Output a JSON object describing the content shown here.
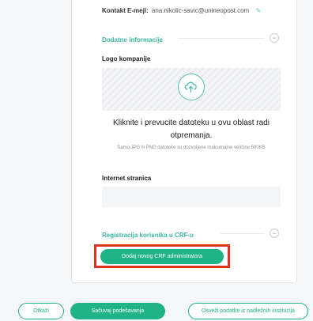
{
  "contact": {
    "label": "Kontakt E-mejl:",
    "value": "ana.nikolic-savic@unineopost.com"
  },
  "additional_info": {
    "title": "Dodatne informacije",
    "toggle_symbol": "−"
  },
  "logo": {
    "label": "Logo kompanije",
    "upload_icon": "cloud-upload-icon",
    "drop_text": "Kliknite i prevucite datoteku u ovu oblast radi otpremanja.",
    "hint": "Samo JPG ili PNG datoteke su dozvoljene maksimalne veličine 500KB"
  },
  "website": {
    "label": "Internet stranica",
    "value": "",
    "placeholder": ""
  },
  "crf_registration": {
    "title": "Registracija korisnika u CRF-u",
    "toggle_symbol": "−",
    "add_admin_label": "Dodaj novog CRF administratora"
  },
  "footer": {
    "cancel_label": "Otkaži",
    "save_label": "Sačuvaj podešavanja",
    "refresh_label": "Osveži podatke iz nadležnih institucija"
  },
  "colors": {
    "accent": "#1fb387",
    "highlight": "#e0311f",
    "section_title": "#3bb8a0"
  }
}
